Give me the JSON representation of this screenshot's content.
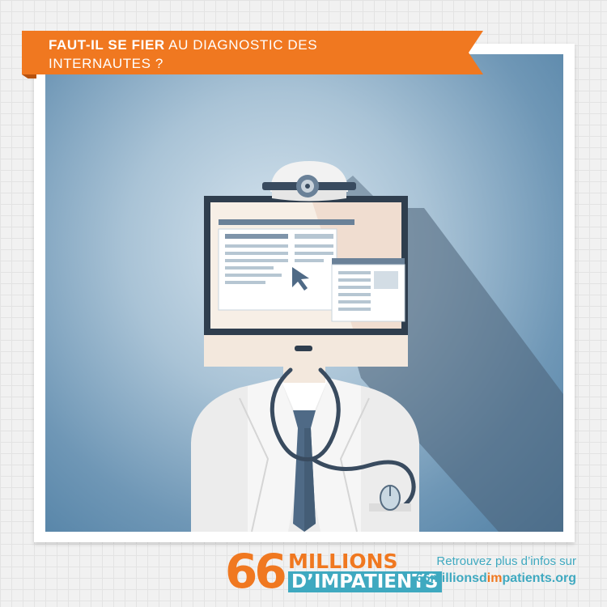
{
  "banner": {
    "title_bold": "FAUT-IL SE FIER",
    "title_rest_line1": " AU DIAGNOSTIC DES",
    "title_line2": "INTERNAUTES ?"
  },
  "logo": {
    "number": "66",
    "word1": "MILLIONS",
    "word2": "D’IMPATIENTS"
  },
  "footer": {
    "line1": "Retrouvez plus d’infos sur",
    "url_part1": "66millionsd",
    "url_part2": "im",
    "url_part3": "patients.org"
  },
  "colors": {
    "orange": "#f07820",
    "teal": "#3fa9c0",
    "navy": "#4f6a86",
    "screen_bg": "#f7efe6"
  },
  "icons": [
    "head-mirror-icon",
    "cursor-icon",
    "stethoscope-icon",
    "mouse-icon"
  ]
}
